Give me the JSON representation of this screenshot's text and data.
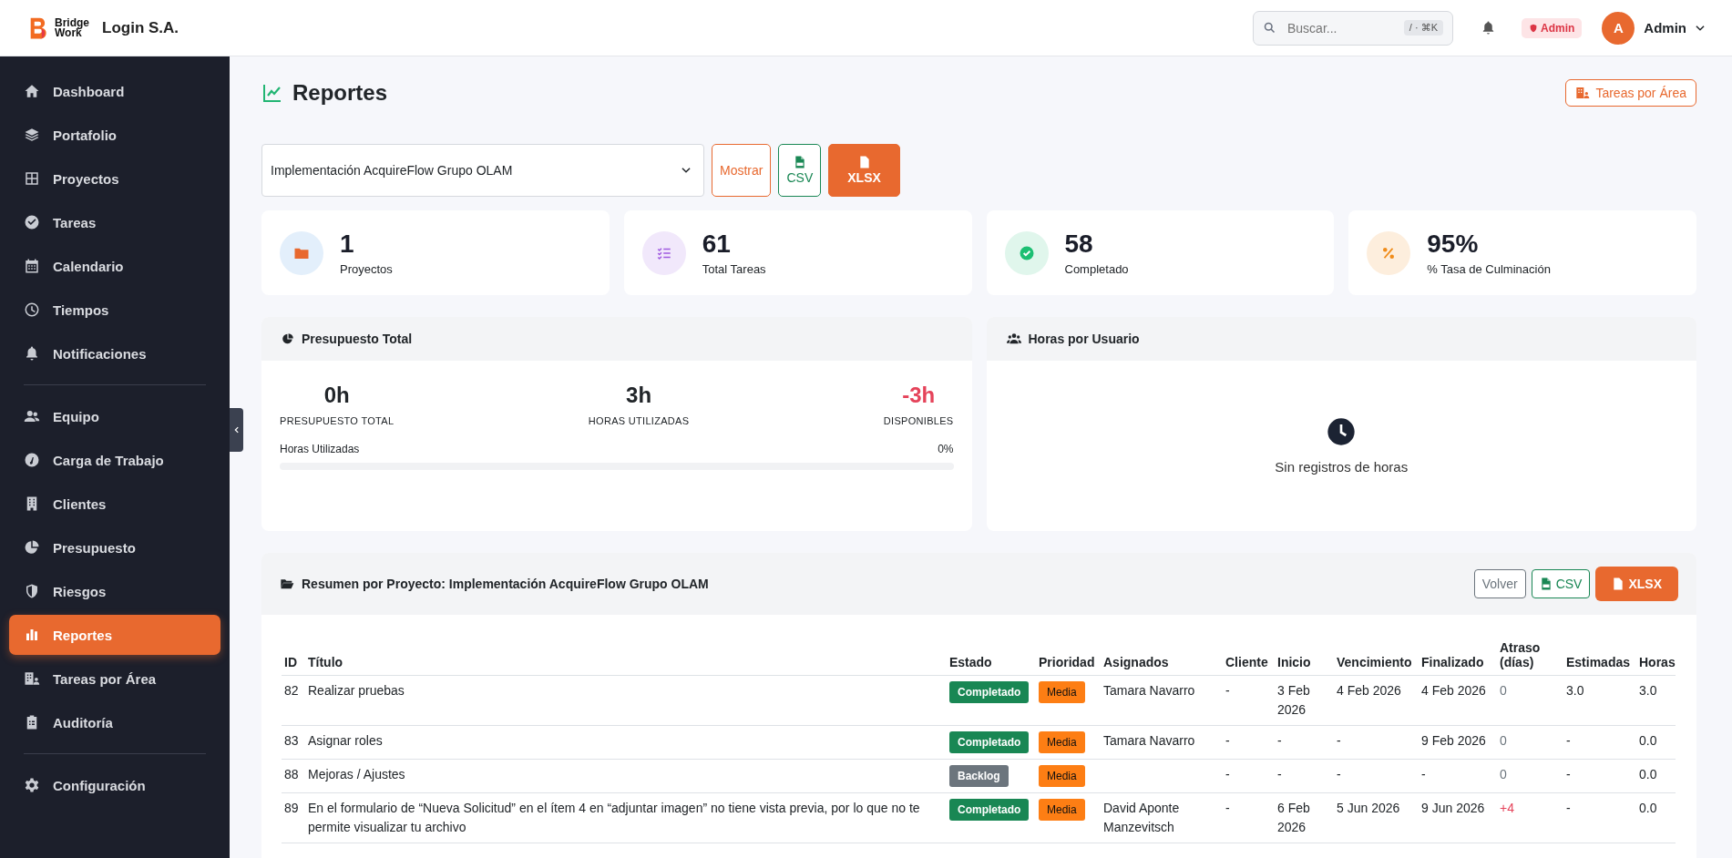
{
  "header": {
    "logo_text": [
      "Bridge",
      "Work"
    ],
    "company": "Login S.A.",
    "search": {
      "placeholder": "Buscar...",
      "shortcut": "/ · ⌘K"
    },
    "role_badge": "Admin",
    "avatar_letter": "A",
    "user": "Admin"
  },
  "sidebar": {
    "groups": [
      [
        {
          "label": "Dashboard",
          "selected": false
        },
        {
          "label": "Portafolio",
          "selected": false
        },
        {
          "label": "Proyectos",
          "selected": false
        },
        {
          "label": "Tareas",
          "selected": false
        },
        {
          "label": "Calendario",
          "selected": false
        },
        {
          "label": "Tiempos",
          "selected": false
        },
        {
          "label": "Notificaciones",
          "selected": false
        }
      ],
      [
        {
          "label": "Equipo",
          "selected": false
        },
        {
          "label": "Carga de Trabajo",
          "selected": false
        },
        {
          "label": "Clientes",
          "selected": false
        },
        {
          "label": "Presupuesto",
          "selected": false
        },
        {
          "label": "Riesgos",
          "selected": false
        },
        {
          "label": "Reportes",
          "selected": true
        },
        {
          "label": "Tareas por Área",
          "selected": false
        },
        {
          "label": "Auditoría",
          "selected": false
        }
      ],
      [
        {
          "label": "Configuración",
          "selected": false
        }
      ]
    ]
  },
  "page": {
    "title": "Reportes",
    "action_button": "Tareas por Área"
  },
  "filter": {
    "project_select": "Implementación AcquireFlow Grupo OLAM",
    "buttons": [
      {
        "label": "Mostrar",
        "kind": "outline"
      },
      {
        "label": "CSV",
        "kind": "csv"
      },
      {
        "label": "XLSX",
        "kind": "xlsx"
      }
    ]
  },
  "stats": [
    {
      "value": "1",
      "label": "Proyectos"
    },
    {
      "value": "61",
      "label": "Total Tareas"
    },
    {
      "value": "58",
      "label": "Completado"
    },
    {
      "value": "95%",
      "label": "% Tasa de Culminación"
    }
  ],
  "budget": {
    "title": "Presupuesto Total",
    "metrics": [
      {
        "value": "0h",
        "label": "PRESUPUESTO TOTAL",
        "negative": false
      },
      {
        "value": "3h",
        "label": "HORAS UTILIZADAS",
        "negative": false
      },
      {
        "value": "-3h",
        "label": "DISPONIBLES",
        "negative": true
      }
    ],
    "progress": {
      "label": "Horas Utilizadas",
      "reading": "0%",
      "level": 0
    }
  },
  "hours_panel": {
    "title": "Horas por Usuario",
    "empty_text": "Sin registros de horas"
  },
  "summary": {
    "title": "Resumen por Proyecto: Implementación AcquireFlow Grupo OLAM",
    "buttons": [
      {
        "label": "Volver",
        "kind": "outline"
      },
      {
        "label": "CSV",
        "kind": "csv"
      },
      {
        "label": "XLSX",
        "kind": "xlsx"
      }
    ],
    "table": {
      "columns": [
        "ID",
        "Título",
        "Estado",
        "Prioridad",
        "Asignados",
        "Cliente",
        "Inicio",
        "Vencimiento",
        "Finalizado",
        "Atraso (días)",
        "Estimadas",
        "Horas"
      ],
      "rows": [
        {
          "id": "82",
          "title": "Realizar pruebas",
          "status": {
            "text": "Completado",
            "kind": "done"
          },
          "priority": "Media",
          "assignees": "Tamara Navarro",
          "client": "-",
          "start": "3 Feb 2026",
          "due": "4 Feb 2026",
          "finished": "4 Feb 2026",
          "delay": {
            "text": "0",
            "overdue": false
          },
          "estimated": "3.0",
          "hours": "3.0"
        },
        {
          "id": "83",
          "title": "Asignar roles",
          "status": {
            "text": "Completado",
            "kind": "done"
          },
          "priority": "Media",
          "assignees": "Tamara Navarro",
          "client": "-",
          "start": "-",
          "due": "-",
          "finished": "9 Feb 2026",
          "delay": {
            "text": "0",
            "overdue": false
          },
          "estimated": "-",
          "hours": "0.0"
        },
        {
          "id": "88",
          "title": "Mejoras / Ajustes",
          "status": {
            "text": "Backlog",
            "kind": "backlog"
          },
          "priority": "Media",
          "client": "-",
          "start": "-",
          "due": "-",
          "finished": "-",
          "delay": {
            "text": "0",
            "overdue": false
          },
          "estimated": "-",
          "hours": "0.0"
        },
        {
          "id": "89",
          "title": "En el formulario de “Nueva Solicitud” en el ítem 4 en “adjuntar imagen” no tiene vista previa, por lo que no te permite visualizar tu archivo",
          "status": {
            "text": "Completado",
            "kind": "done"
          },
          "priority": "Media",
          "assignees": "David Aponte Manzevitsch",
          "client": "-",
          "start": "6 Feb 2026",
          "due": "5 Jun 2026",
          "finished": "9 Jun 2026",
          "delay": {
            "text": "+4",
            "overdue": true
          },
          "estimated": "-",
          "hours": "0.0"
        }
      ]
    }
  }
}
